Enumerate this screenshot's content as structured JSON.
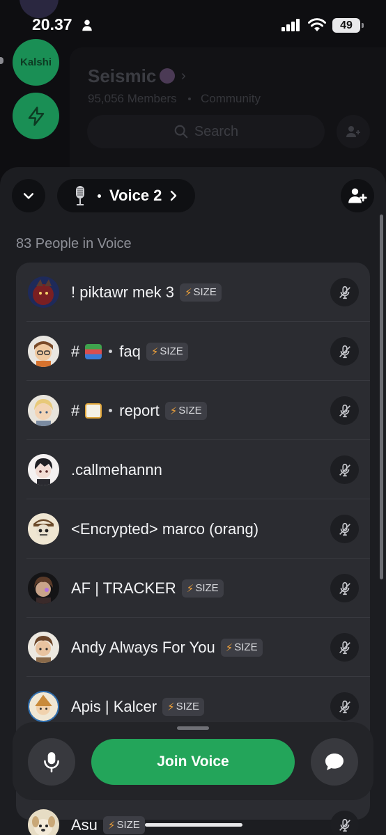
{
  "status_bar": {
    "time": "20.37",
    "battery": "49"
  },
  "background": {
    "server_rail": [
      {
        "label": "Kalshi",
        "color": "#1a8f55"
      },
      {
        "icon": "lightning-icon",
        "color": "#1a8f55"
      }
    ],
    "server_name": "Seismic",
    "members": "95,056 Members",
    "type": "Community",
    "search_placeholder": "Search"
  },
  "sheet": {
    "channel_name": "Voice 2",
    "people_count_label": "83 People in Voice",
    "size_tag": "SIZE",
    "members": [
      {
        "name": "! piktawr mek 3",
        "size_tag": true,
        "avatar_color": "#7a1f22"
      },
      {
        "prefix": "#",
        "emoji": "books-emoji",
        "sep": true,
        "name": "faq",
        "size_tag": true,
        "avatar_color": "#c9a176"
      },
      {
        "prefix": "#",
        "emoji": "memo-emoji",
        "sep": true,
        "name": "report",
        "size_tag": true,
        "avatar_color": "#e2c99a"
      },
      {
        "name": ".callmehannn",
        "size_tag": false,
        "avatar_color": "#e8e0e0"
      },
      {
        "name": "<Encrypted> marco (orang)",
        "size_tag": false,
        "avatar_color": "#e9dcc2"
      },
      {
        "name": "AF | TRACKER",
        "size_tag": true,
        "avatar_color": "#3a2a2a"
      },
      {
        "name": "Andy Always For You",
        "size_tag": true,
        "avatar_color": "#d9c6a8"
      },
      {
        "name": "Apis | Kalcer",
        "size_tag": true,
        "avatar_color": "#2f6fb0"
      },
      {
        "name": "Asu",
        "size_tag": true,
        "avatar_color": "#d8c8a0"
      }
    ],
    "join_button": "Join Voice",
    "accent": "#23a55a"
  }
}
